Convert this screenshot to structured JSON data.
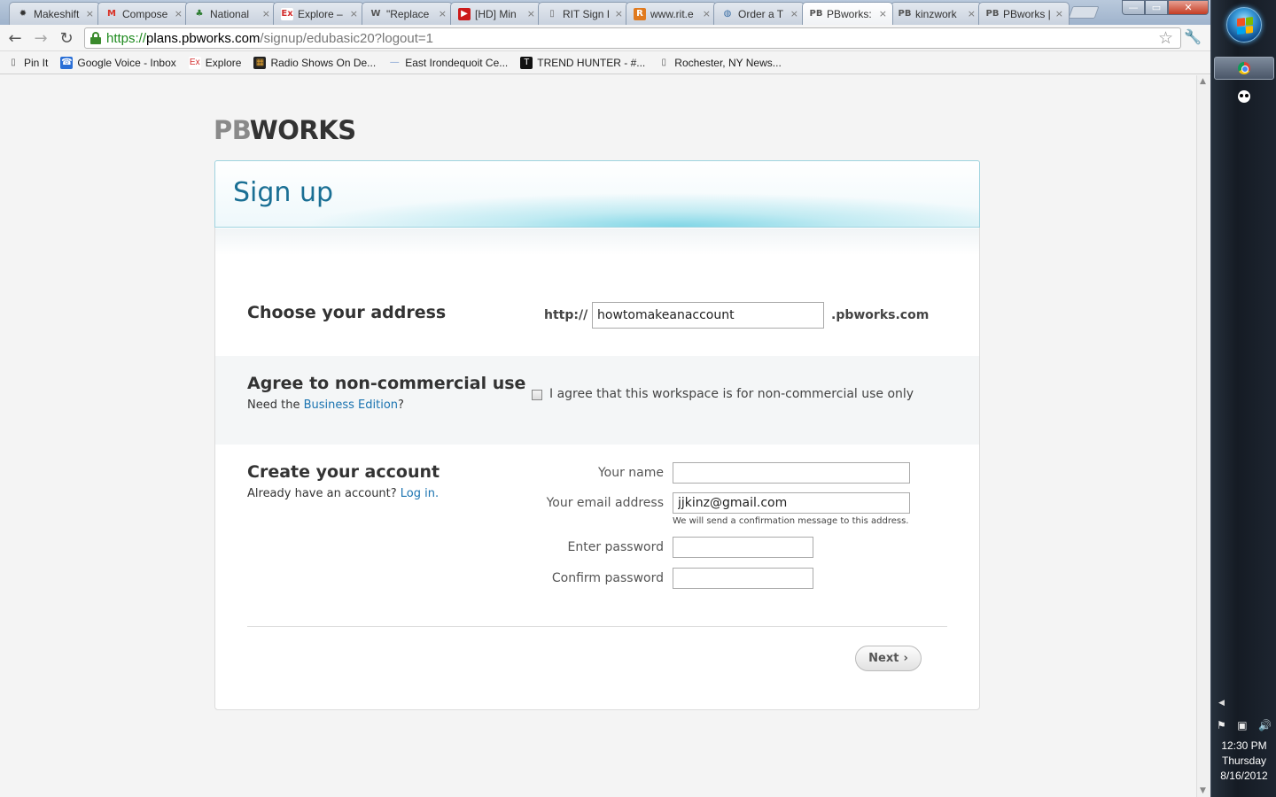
{
  "browser": {
    "tabs": [
      {
        "title": "Makeshift",
        "favicon": "makeshift-icon",
        "fav_glyph": "✹",
        "fav_color": "#333333",
        "fav_bg": "transparent"
      },
      {
        "title": "Compose",
        "favicon": "gmail-icon",
        "fav_glyph": "M",
        "fav_color": "#d93025",
        "fav_bg": "transparent"
      },
      {
        "title": "National",
        "favicon": "trees-icon",
        "fav_glyph": "♣",
        "fav_color": "#2e7d32",
        "fav_bg": "transparent"
      },
      {
        "title": "Explore –",
        "favicon": "explore-icon",
        "fav_glyph": "Ex",
        "fav_color": "#d32f2f",
        "fav_bg": "#ffffff"
      },
      {
        "title": "\"Replace",
        "favicon": "wordpress-icon",
        "fav_glyph": "W",
        "fav_color": "#555555",
        "fav_bg": "transparent"
      },
      {
        "title": "[HD] Min",
        "favicon": "youtube-icon",
        "fav_glyph": "▶",
        "fav_color": "#ffffff",
        "fav_bg": "#cc1a1a"
      },
      {
        "title": "RIT Sign I",
        "favicon": "page-icon",
        "fav_glyph": "▯",
        "fav_color": "#666666",
        "fav_bg": "transparent"
      },
      {
        "title": "www.rit.e",
        "favicon": "rit-icon",
        "fav_glyph": "R",
        "fav_color": "#ffffff",
        "fav_bg": "#e07a1f"
      },
      {
        "title": "Order a T",
        "favicon": "globe-icon",
        "fav_glyph": "◍",
        "fav_color": "#3a6ea5",
        "fav_bg": "transparent"
      },
      {
        "title": "PBworks:",
        "favicon": "pbworks-icon",
        "fav_glyph": "PB",
        "fav_color": "#555555",
        "fav_bg": "transparent",
        "active": true
      },
      {
        "title": "kinzwork",
        "favicon": "pbworks-icon",
        "fav_glyph": "PB",
        "fav_color": "#555555",
        "fav_bg": "transparent"
      },
      {
        "title": "PBworks |",
        "favicon": "pbworks-icon",
        "fav_glyph": "PB",
        "fav_color": "#555555",
        "fav_bg": "transparent"
      }
    ],
    "tab_close_glyph": "×",
    "window_controls": {
      "minimize": "—",
      "maximize": "▭",
      "close": "✕"
    },
    "nav": {
      "back": "←",
      "forward": "→",
      "reload": "↻"
    },
    "url": {
      "scheme": "https://",
      "host": "plans.pbworks.com",
      "path": "/signup/edubasic20?logout=1"
    },
    "star": "☆",
    "wrench": "🔧",
    "bookmarks": [
      {
        "label": "Pin It",
        "icon": "page-icon",
        "glyph": "▯",
        "color": "#555555",
        "bg": "transparent"
      },
      {
        "label": "Google Voice - Inbox",
        "icon": "google-voice-icon",
        "glyph": "☎",
        "color": "#ffffff",
        "bg": "#2a6fd6"
      },
      {
        "label": "Explore",
        "icon": "explore-icon",
        "glyph": "Ex",
        "color": "#d32f2f",
        "bg": "#ffffff"
      },
      {
        "label": "Radio Shows On De...",
        "icon": "radio-icon",
        "glyph": "▦",
        "color": "#e0a030",
        "bg": "#222222"
      },
      {
        "label": "East Irondequoit Ce...",
        "icon": "dash-icon",
        "glyph": "—",
        "color": "#7a9ccf",
        "bg": "transparent"
      },
      {
        "label": "TREND HUNTER - #...",
        "icon": "trendhunter-icon",
        "glyph": "T",
        "color": "#ffffff",
        "bg": "#111111"
      },
      {
        "label": "Rochester, NY News...",
        "icon": "page-icon",
        "glyph": "▯",
        "color": "#555555",
        "bg": "transparent"
      }
    ]
  },
  "page": {
    "logo": {
      "pb": "PB",
      "works": "WORKS"
    },
    "title": "Sign up",
    "address": {
      "heading": "Choose your address",
      "prefix": "http://",
      "value": "howtomakeanaccount",
      "suffix": ".pbworks.com"
    },
    "noncommercial": {
      "heading": "Agree to non-commercial use",
      "sub_prefix": "Need the ",
      "sub_link": "Business Edition",
      "sub_suffix": "?",
      "checkbox_label": "I agree that this workspace is for non-commercial use only",
      "checked": false
    },
    "account": {
      "heading": "Create your account",
      "sub_prefix": "Already have an account? ",
      "sub_link": "Log in.",
      "name_label": "Your name",
      "name_value": "",
      "email_label": "Your email address",
      "email_value": "jjkinz@gmail.com",
      "email_hint": "We will send a confirmation message to this address.",
      "password_label": "Enter password",
      "password_value": "",
      "confirm_label": "Confirm password",
      "confirm_value": ""
    },
    "next_label": "Next",
    "next_glyph": "›"
  },
  "taskbar": {
    "tray_arrow": "◀",
    "tray": [
      "⚑",
      "▣",
      "🔊"
    ],
    "time": "12:30 PM",
    "day": "Thursday",
    "date": "8/16/2012"
  }
}
